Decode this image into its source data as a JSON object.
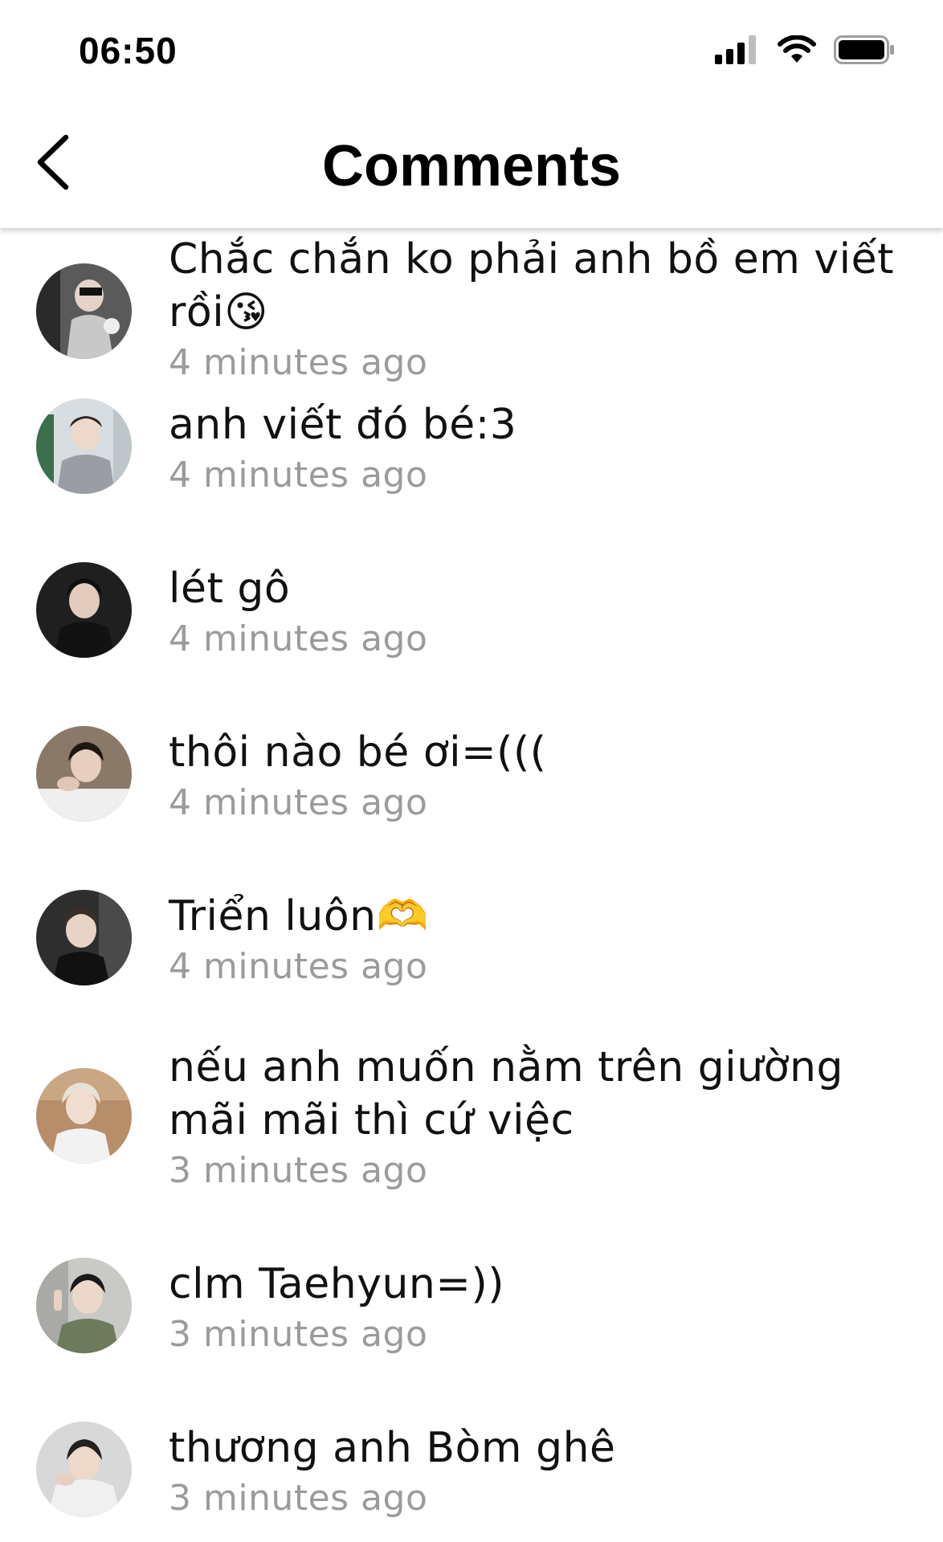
{
  "status_bar": {
    "time": "06:50",
    "icons": [
      "cellular-signal-icon",
      "wifi-icon",
      "battery-icon"
    ]
  },
  "header": {
    "title": "Comments",
    "back_icon": "chevron-left-icon"
  },
  "comments": [
    {
      "text": "Chắc chắn ko phải anh bồ em viết rồi😘",
      "time": "4 minutes ago"
    },
    {
      "text": "anh viết đó bé:3",
      "time": "4 minutes ago"
    },
    {
      "text": "lét gô",
      "time": "4 minutes ago"
    },
    {
      "text": "thôi nào bé ơi=(((",
      "time": "4 minutes ago"
    },
    {
      "text": "Triển luôn🫶",
      "time": "4 minutes ago"
    },
    {
      "text": "nếu anh muốn nằm trên giường mãi mãi thì cứ việc",
      "time": "3 minutes ago"
    },
    {
      "text": "clm Taehyun=))",
      "time": "3 minutes ago"
    },
    {
      "text": "thương anh Bòm ghê",
      "time": "3 minutes ago"
    }
  ],
  "colors": {
    "text_primary": "#111111",
    "text_secondary": "#9b9b9b",
    "background": "#ffffff"
  }
}
